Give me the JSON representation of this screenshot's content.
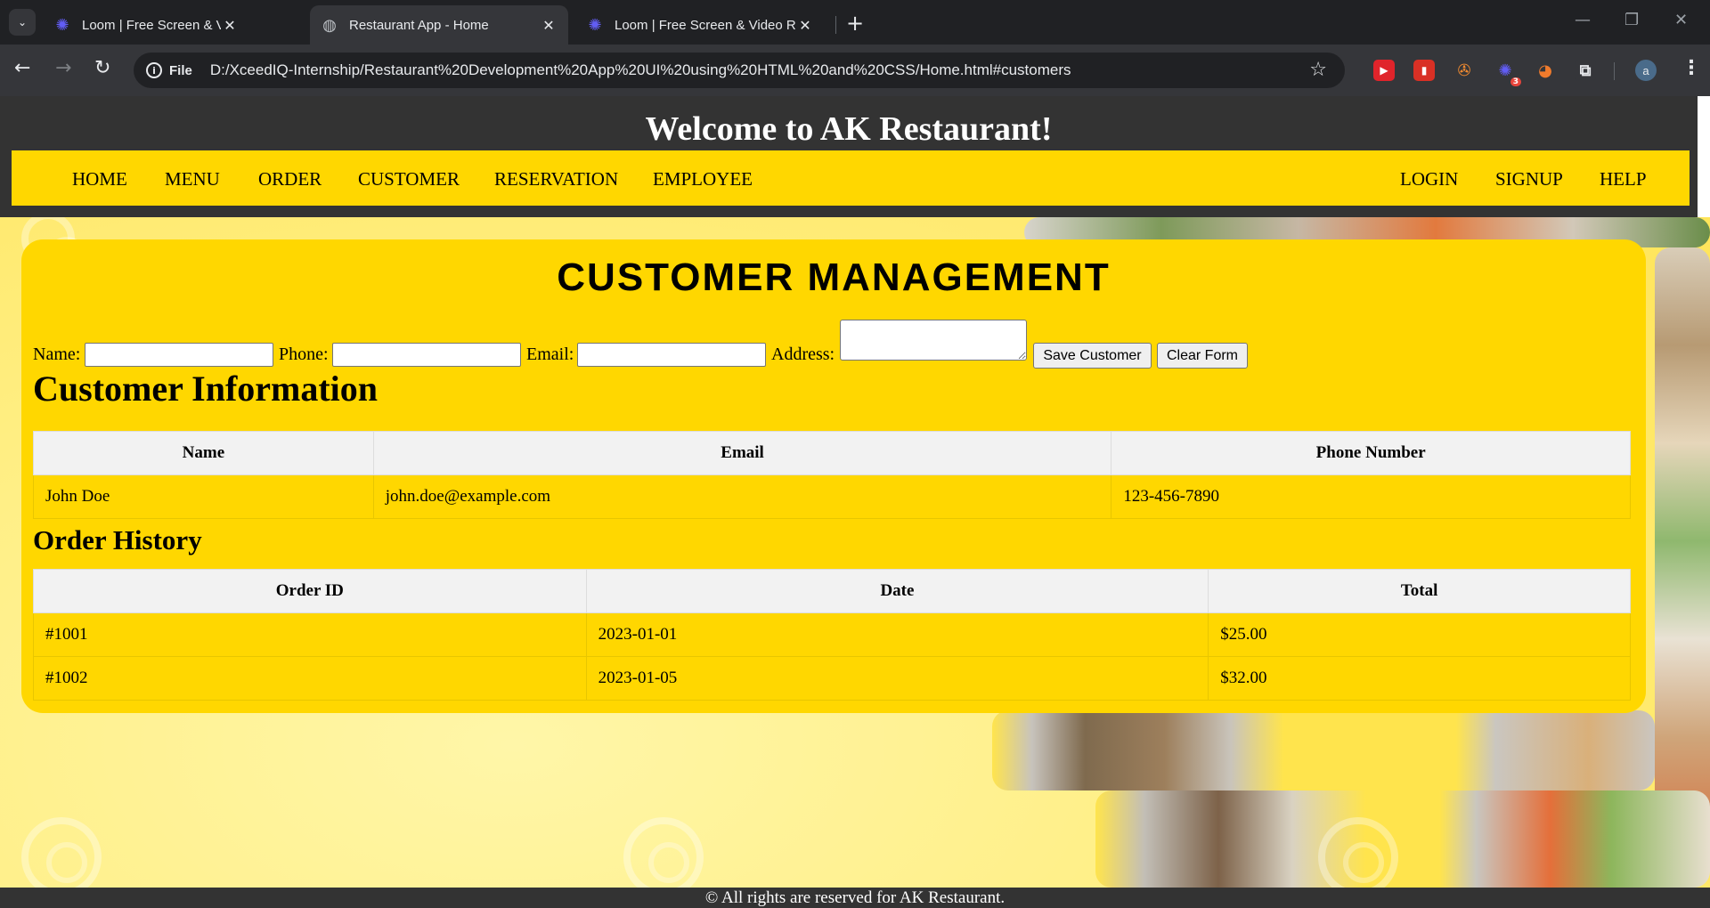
{
  "browser": {
    "tabs": [
      {
        "title": "Loom | Free Screen & Video Rec",
        "icon": "loom-icon",
        "active": false
      },
      {
        "title": "Restaurant App - Home",
        "icon": "globe-icon",
        "active": true
      },
      {
        "title": "Loom | Free Screen & Video Rec",
        "icon": "loom-icon",
        "active": false
      }
    ],
    "new_tab": "+",
    "address": {
      "scheme_label": "File",
      "url": "D:/XceedIQ-Internship/Restaurant%20Development%20App%20UI%20using%20HTML%20and%20CSS/Home.html#customers"
    },
    "profile_initial": "a",
    "extension_badge": "3"
  },
  "site": {
    "title": "Welcome to AK Restaurant!",
    "nav_left": [
      "HOME",
      "MENU",
      "ORDER",
      "CUSTOMER",
      "RESERVATION",
      "EMPLOYEE"
    ],
    "nav_right": [
      "LOGIN",
      "SIGNUP",
      "HELP"
    ]
  },
  "customer_management": {
    "heading": "CUSTOMER MANAGEMENT",
    "form": {
      "name_label": "Name:",
      "phone_label": "Phone:",
      "email_label": "Email:",
      "address_label": "Address:",
      "name_value": "",
      "phone_value": "",
      "email_value": "",
      "address_value": "",
      "save_button": "Save Customer",
      "clear_button": "Clear Form"
    },
    "info": {
      "heading": "Customer Information",
      "columns": [
        "Name",
        "Email",
        "Phone Number"
      ],
      "rows": [
        [
          "John Doe",
          "john.doe@example.com",
          "123-456-7890"
        ]
      ]
    },
    "orders": {
      "heading": "Order History",
      "columns": [
        "Order ID",
        "Date",
        "Total"
      ],
      "rows": [
        [
          "#1001",
          "2023-01-01",
          "$25.00"
        ],
        [
          "#1002",
          "2023-01-05",
          "$32.00"
        ]
      ]
    }
  },
  "footer": {
    "text": "© All rights are reserved for AK Restaurant."
  },
  "colors": {
    "header_bg": "#333333",
    "nav_bg": "#ffd700",
    "card_bg": "#ffd700",
    "table_header_bg": "#f2f2f2"
  }
}
